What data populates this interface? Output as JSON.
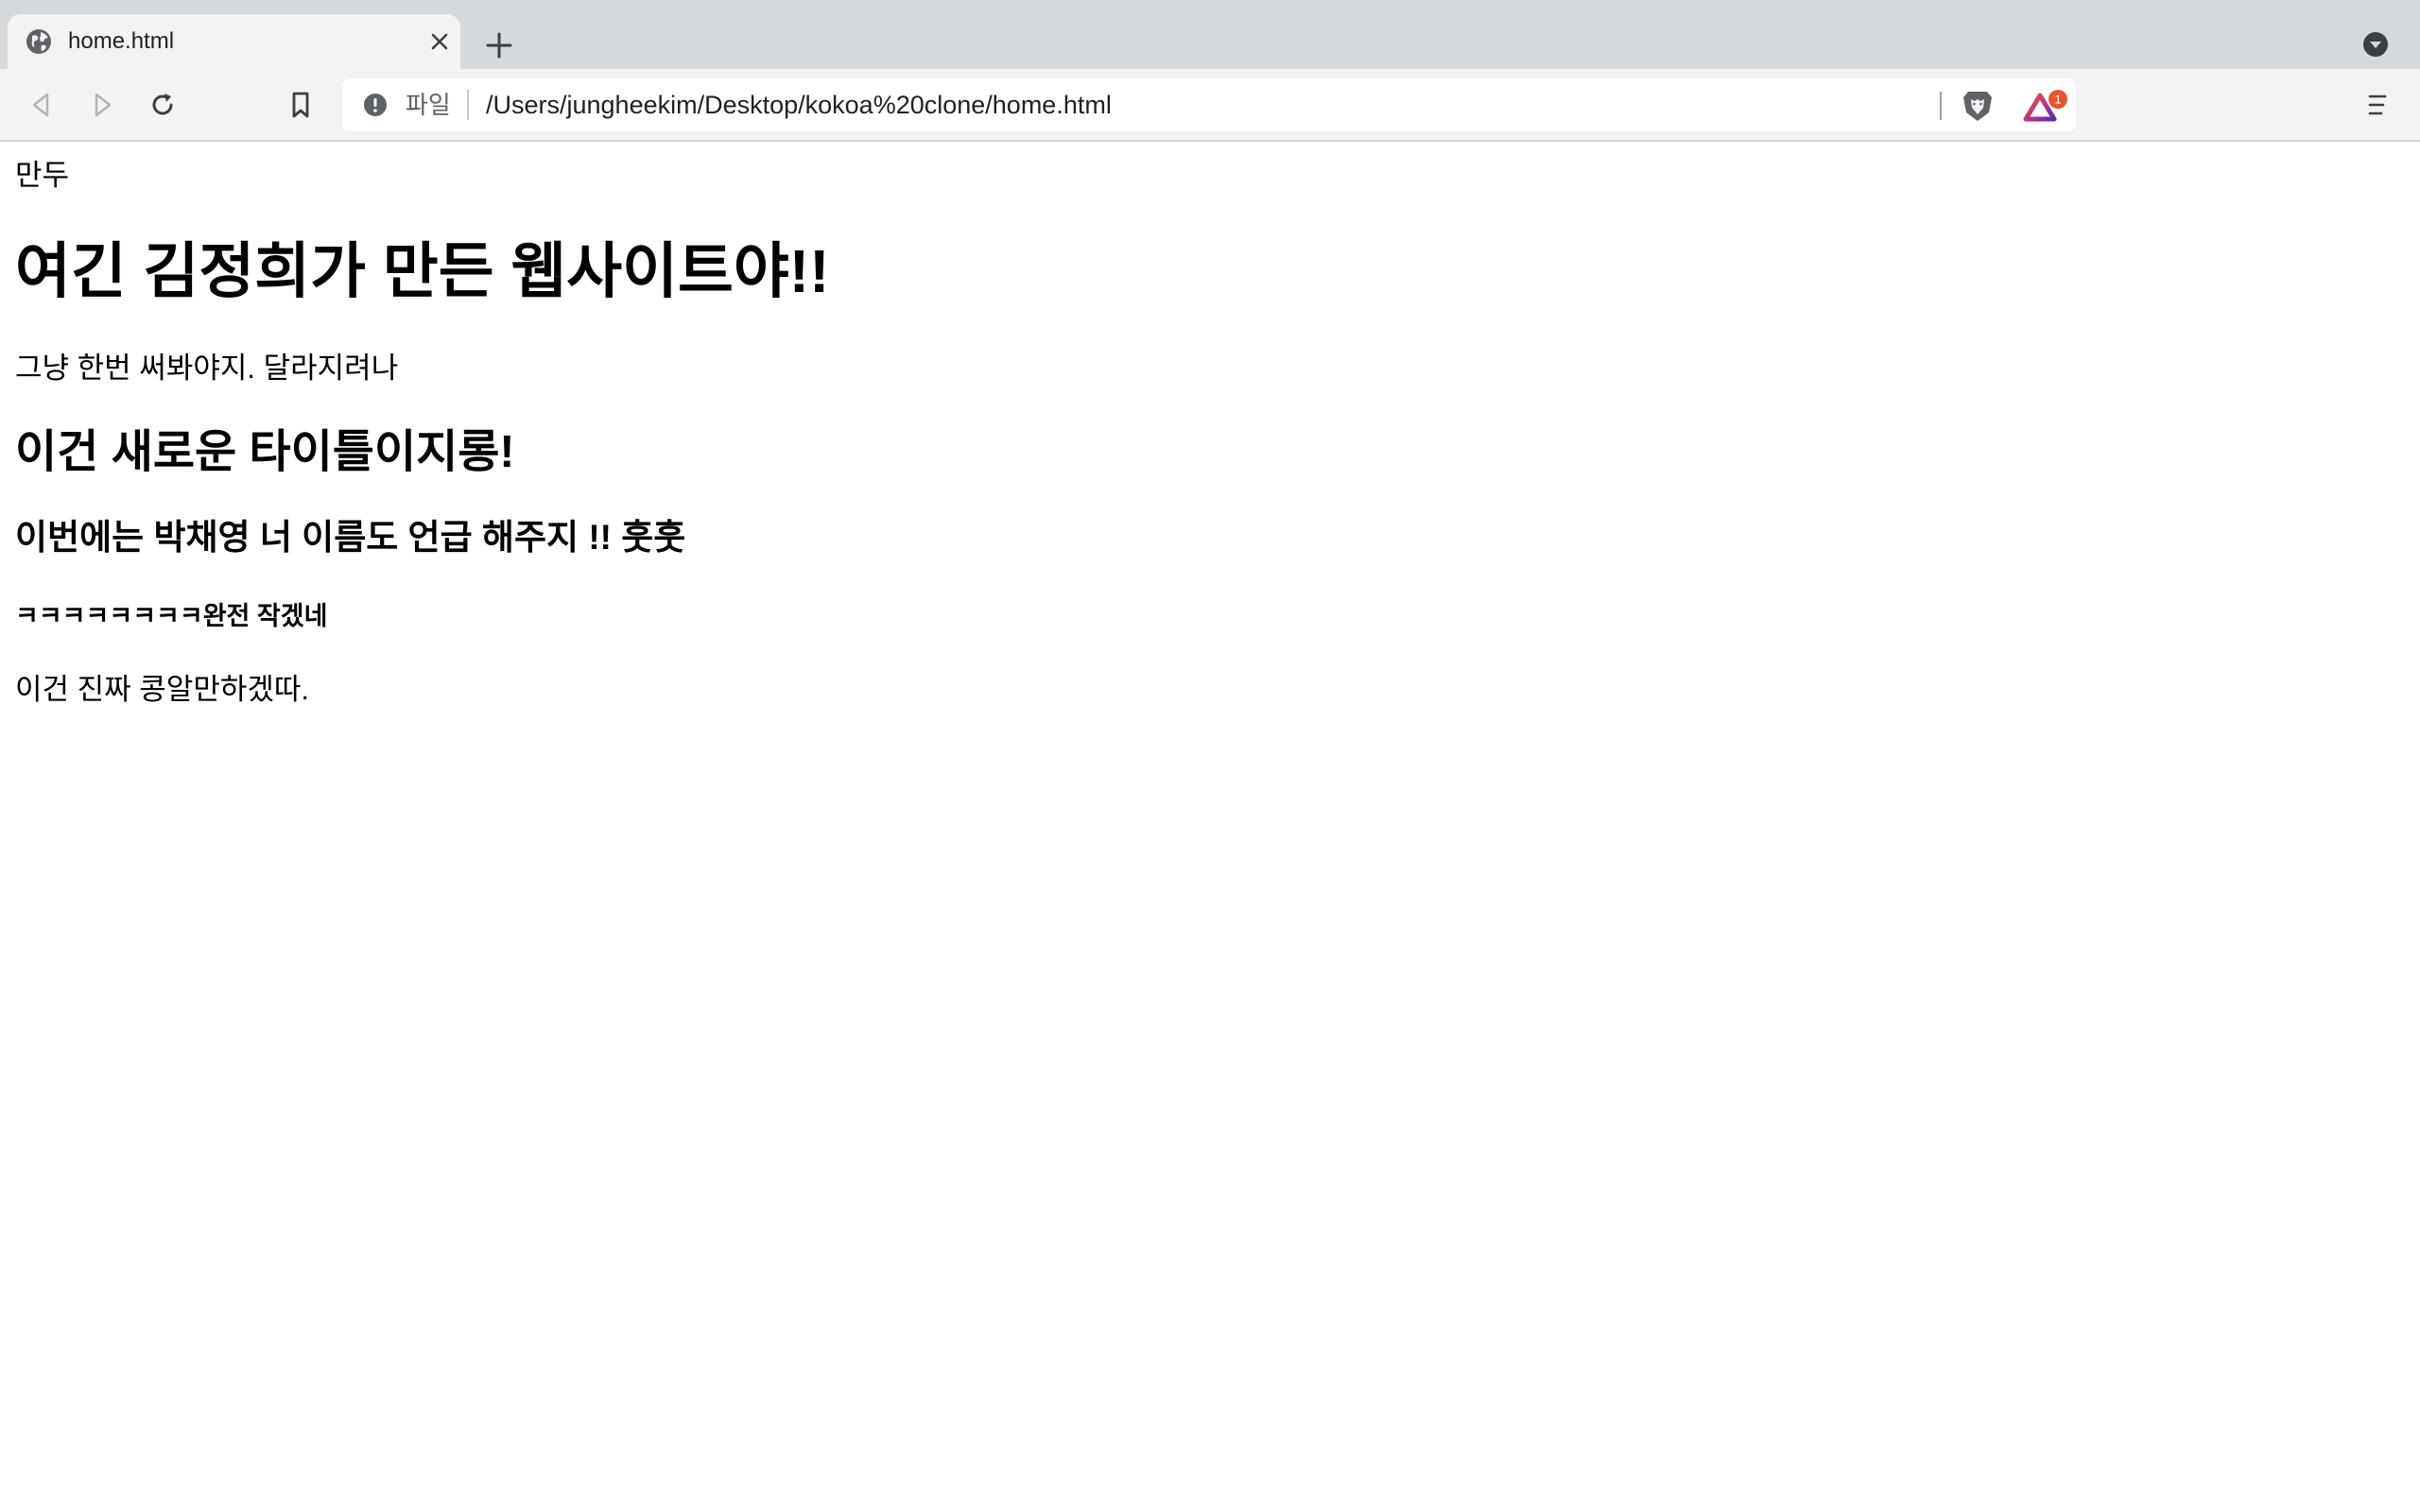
{
  "browser": {
    "tab": {
      "title": "home.html",
      "favicon": "globe-icon",
      "close_icon": "close-icon"
    },
    "new_tab_icon": "plus-icon",
    "tab_menu_icon": "chevron-down-circle-icon",
    "toolbar": {
      "back_icon": "back-arrow-icon",
      "forward_icon": "forward-arrow-icon",
      "reload_icon": "reload-icon",
      "bookmark_icon": "bookmark-icon"
    },
    "omnibox": {
      "security_icon": "info-icon",
      "scheme_label": "파일",
      "url": "/Users/jungheekim/Desktop/kokoa%20clone/home.html",
      "shield_icon": "brave-shield-icon",
      "rewards_icon": "brave-rewards-icon",
      "rewards_badge": "1"
    },
    "menu_icon": "hamburger-menu-icon",
    "colors": {
      "tabstrip_bg": "#d6d9dc",
      "toolbar_bg": "#f2f3f4",
      "badge_bg": "#e8552b"
    }
  },
  "page": {
    "lines": [
      {
        "tag": "text",
        "text": "만두"
      },
      {
        "tag": "h1",
        "text": "여긴 김정희가 만든 웹사이트야!!"
      },
      {
        "tag": "p",
        "text": "그냥 한번 써봐야지. 달라지려나"
      },
      {
        "tag": "h2",
        "text": "이건 새로운 타이틀이지롱!"
      },
      {
        "tag": "h3",
        "text": "이번에는 박채영 너 이름도 언급 해주지 !! 훗훗"
      },
      {
        "tag": "h4",
        "text": "ㅋㅋㅋㅋㅋㅋㅋㅋ완전 작겠네"
      },
      {
        "tag": "p",
        "text": "이건 진짜 콩알만하겠따."
      }
    ]
  }
}
